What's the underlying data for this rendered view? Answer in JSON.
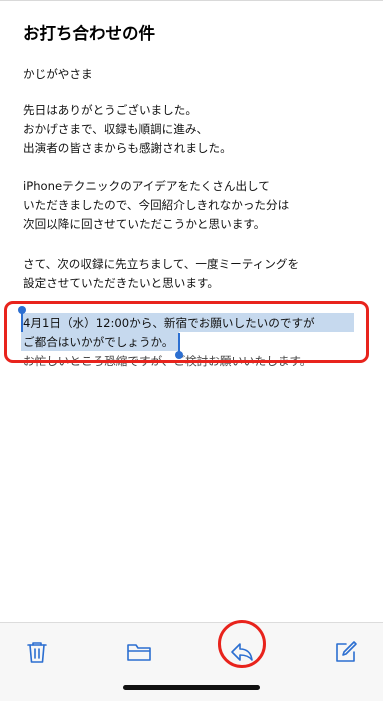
{
  "email": {
    "subject": "お打ち合わせの件",
    "lines": [
      "かじがやさま",
      "先日はありがとうございました。",
      "おかげさまで、収録も順調に進み、",
      "出演者の皆さまからも感謝されました。",
      "iPhoneテクニックのアイデアをたくさん出して",
      "いただきましたので、今回紹介しきれなかった分は",
      "次回以降に回させていただこうかと思います。",
      "さて、次の収録に先立ちまして、一度ミーティングを",
      "設定させていただきたいと思います。"
    ],
    "selected_lines": [
      "4月1日（水）12:00から、新宿でお願いしたいのですが",
      "ご都合はいかがでしょうか。"
    ],
    "obscured_line": "お忙しいところ恐縮ですが、ご検討お願いいたします。"
  },
  "toolbar": {
    "icons": [
      "trash-icon",
      "folder-icon",
      "reply-icon",
      "compose-icon"
    ]
  },
  "colors": {
    "accent": "#2c6fd1",
    "selection": "#c6d9ee",
    "annotation": "#e8231c"
  }
}
